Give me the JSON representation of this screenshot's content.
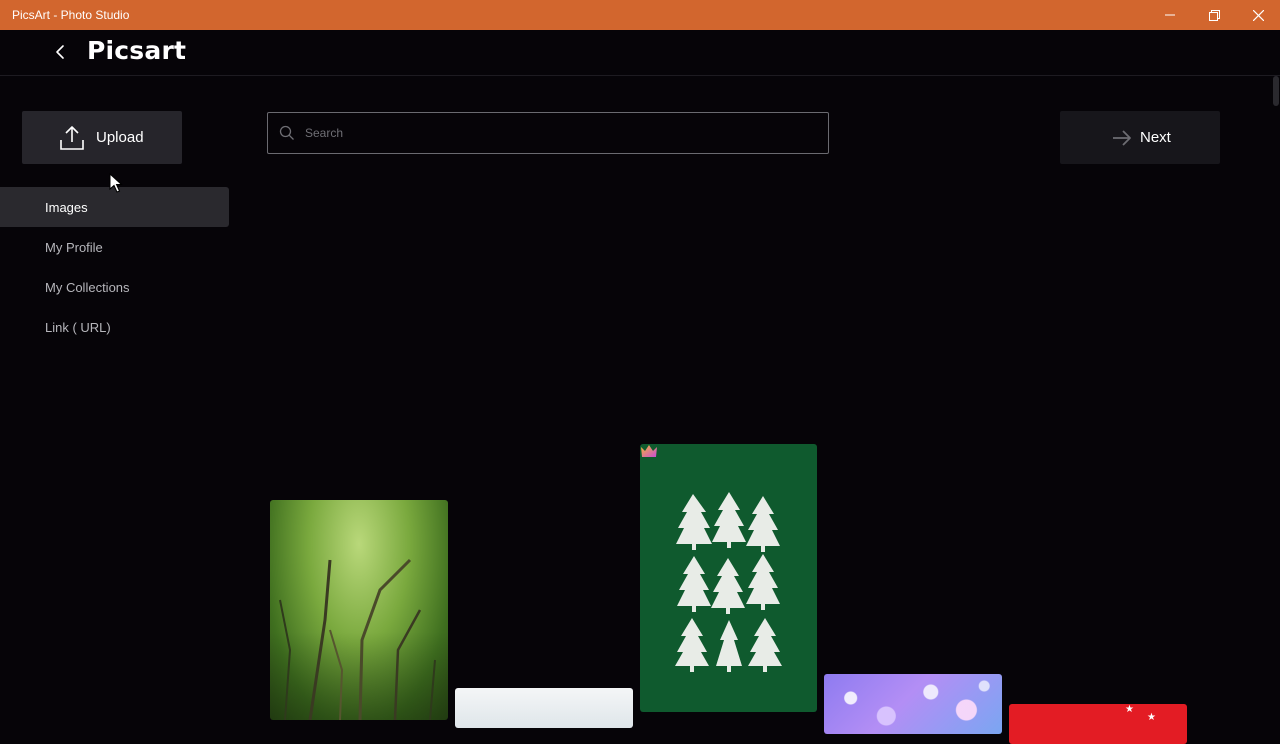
{
  "window": {
    "title": "PicsArt - Photo Studio",
    "controls": {
      "minimize": "minimize-icon",
      "restore": "restore-icon",
      "close": "close-icon"
    },
    "accent": "#d2662e"
  },
  "header": {
    "logo": "Picsart",
    "back_icon": "chevron-left-icon"
  },
  "upload": {
    "label": "Upload",
    "icon": "upload-icon"
  },
  "search": {
    "placeholder": "Search",
    "value": "",
    "icon": "search-icon"
  },
  "next": {
    "label": "Next",
    "icon": "arrow-right-icon"
  },
  "sidebar": {
    "items": [
      {
        "label": "Images",
        "active": true
      },
      {
        "label": "My Profile",
        "active": false
      },
      {
        "label": "My Collections",
        "active": false
      },
      {
        "label": "Link ( URL)",
        "active": false
      }
    ]
  },
  "gallery": {
    "tiles": [
      {
        "name": "forest-image",
        "premium": false
      },
      {
        "name": "snowy-landscape-image",
        "premium": false
      },
      {
        "name": "paper-christmas-trees-image",
        "premium": true
      },
      {
        "name": "purple-bokeh-image",
        "premium": false
      },
      {
        "name": "red-stars-image",
        "premium": false
      }
    ]
  },
  "colors": {
    "background": "#060408",
    "panel": "#26252b",
    "active_nav": "#2a292e"
  }
}
